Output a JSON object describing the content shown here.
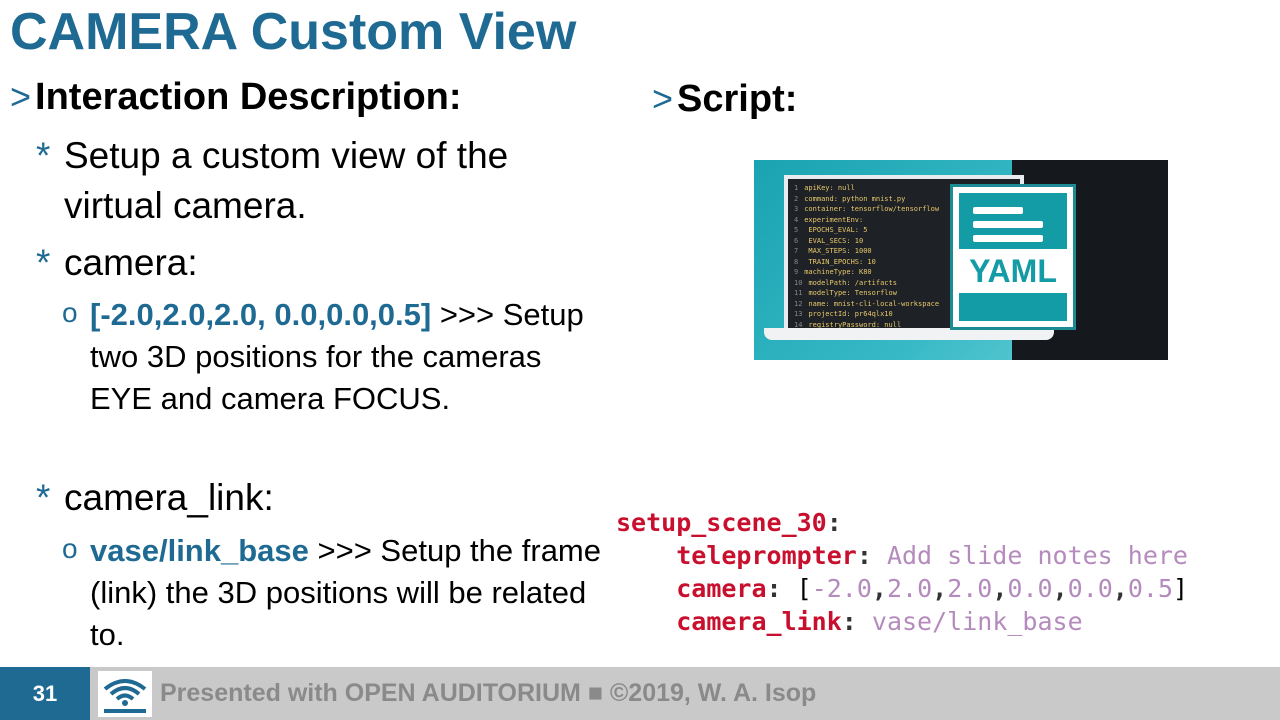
{
  "slide": {
    "title": "CAMERA Custom View",
    "left_heading": "Interaction Description:",
    "right_heading": "Script:",
    "heading_marker": ">",
    "bullet_marker": "*",
    "sub_marker": "o",
    "bullets": [
      {
        "text": "Setup a custom view of the virtual camera."
      },
      {
        "text": "camera:",
        "sub": {
          "highlight": "[-2.0,2.0,2.0, 0.0,0.0,0.5]",
          "rest": " >>> Setup two 3D positions for the cameras EYE and camera FOCUS."
        }
      },
      {
        "text": "camera_link:",
        "sub": {
          "highlight": "vase/link_base",
          "rest": " >>> Setup the frame (link) the 3D positions will be related to."
        }
      }
    ]
  },
  "yaml_image": {
    "label": "YAML",
    "code_lines": [
      "apiKey: null",
      "command: python mnist.py",
      "container: tensorflow/tensorflow",
      "experimentEnv:",
      "  EPOCHS_EVAL: 5",
      "  EVAL_SECS: 10",
      "  MAX_STEPS: 1000",
      "  TRAIN_EPOCHS: 10",
      "machineType: K80",
      "modelPath: /artifacts",
      "modelType: Tensorflow",
      "name: mnist-cli-local-workspace",
      "projectId: pr64qlx10",
      "registryPassword: null"
    ]
  },
  "code": {
    "scene_key": "setup_scene_30",
    "teleprompter_key": "teleprompter",
    "teleprompter_value": "Add slide notes here",
    "camera_key": "camera",
    "camera_values": [
      "-2.0",
      "2.0",
      "2.0",
      "0.0",
      "0.0",
      "0.5"
    ],
    "camera_link_key": "camera_link",
    "camera_link_value": "vase/link_base"
  },
  "footer": {
    "page_number": "31",
    "text": "Presented with OPEN AUDITORIUM ■ ©2019, W. A. Isop",
    "logo_icon": "wifi-logo-icon"
  },
  "colors": {
    "accent": "#1f6a93",
    "code_key": "#c8102e",
    "code_value": "#b58bbd",
    "footer_bg": "#c9c9c9"
  }
}
